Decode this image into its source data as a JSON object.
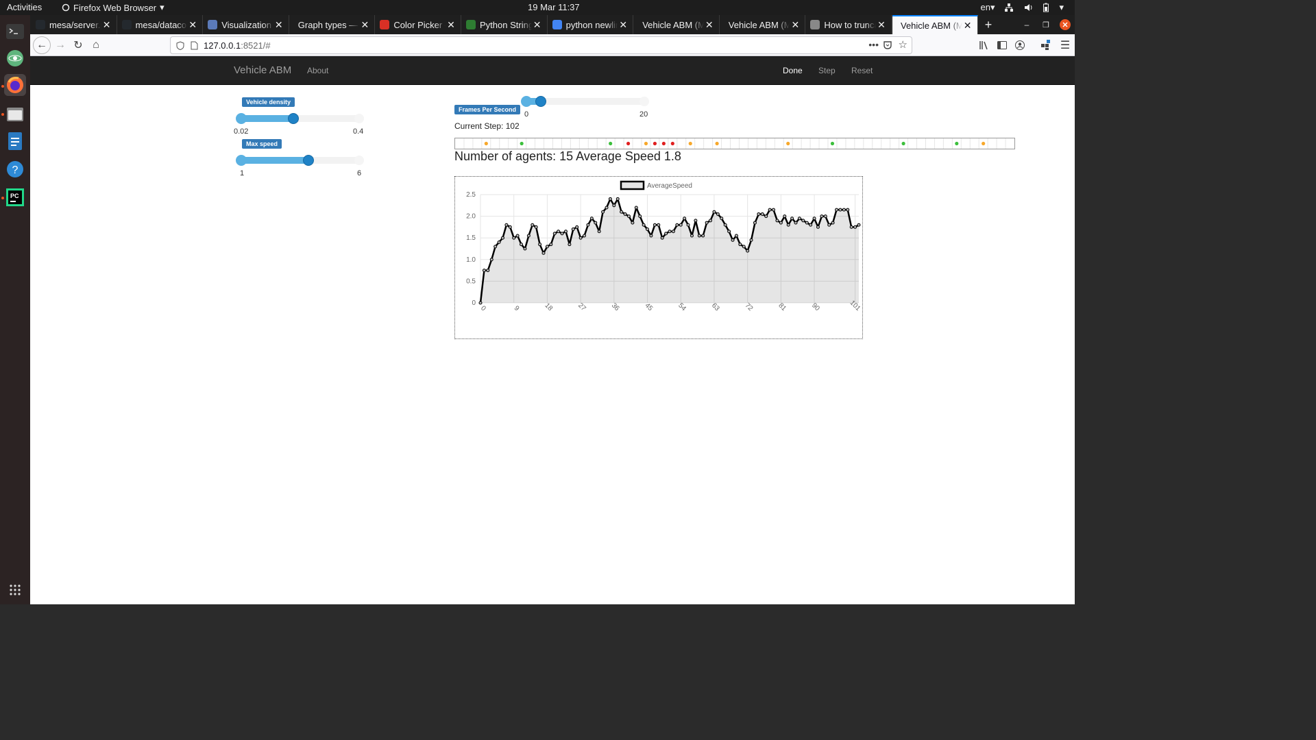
{
  "system": {
    "activities": "Activities",
    "app_menu": "Firefox Web Browser",
    "clock": "19 Mar  11:37",
    "lang": "en"
  },
  "tabs": [
    {
      "label": "mesa/server.p",
      "favicon_color": "#24292e"
    },
    {
      "label": "mesa/datacoll",
      "favicon_color": "#24292e"
    },
    {
      "label": "Visualization",
      "favicon_color": "#5b7ab8"
    },
    {
      "label": "Graph types — N",
      "favicon_color": ""
    },
    {
      "label": "Color Picker –",
      "favicon_color": "#d93025"
    },
    {
      "label": "Python String",
      "favicon_color": "#2e7d32"
    },
    {
      "label": "python newlin",
      "favicon_color": "#4285f4"
    },
    {
      "label": "Vehicle ABM (Me",
      "favicon_color": ""
    },
    {
      "label": "Vehicle ABM (Me",
      "favicon_color": ""
    },
    {
      "label": "How to trunca",
      "favicon_color": "#888888"
    },
    {
      "label": "Vehicle ABM (Me",
      "favicon_color": "",
      "active": true
    }
  ],
  "url": {
    "host": "127.0.0.1",
    "rest": ":8521/#"
  },
  "app": {
    "brand": "Vehicle ABM",
    "about": "About",
    "done": "Done",
    "step": "Step",
    "reset": "Reset"
  },
  "controls": {
    "vehicle_density": {
      "label": "Vehicle density",
      "min": "0.02",
      "max": "0.4",
      "value_fraction": 0.47
    },
    "max_speed": {
      "label": "Max speed",
      "min": "1",
      "max": "6",
      "value_fraction": 0.6
    },
    "fps": {
      "label": "Frames Per Second",
      "min": "0",
      "max": "20",
      "value_fraction": 0.15
    }
  },
  "status": {
    "current_step": "Current Step: 102",
    "agents_text": "Number of agents: 15 Average Speed 1.8"
  },
  "agents_row": {
    "colors": {
      "green": "#3cbf3c",
      "orange": "#f7a82b",
      "red": "#e02020"
    },
    "cells": 63,
    "agents": [
      {
        "cell": 3,
        "color": "orange"
      },
      {
        "cell": 7,
        "color": "green"
      },
      {
        "cell": 17,
        "color": "green"
      },
      {
        "cell": 19,
        "color": "red"
      },
      {
        "cell": 21,
        "color": "orange"
      },
      {
        "cell": 22,
        "color": "red"
      },
      {
        "cell": 23,
        "color": "red"
      },
      {
        "cell": 24,
        "color": "red"
      },
      {
        "cell": 26,
        "color": "orange"
      },
      {
        "cell": 29,
        "color": "orange"
      },
      {
        "cell": 37,
        "color": "orange"
      },
      {
        "cell": 42,
        "color": "green"
      },
      {
        "cell": 50,
        "color": "green"
      },
      {
        "cell": 56,
        "color": "green"
      },
      {
        "cell": 59,
        "color": "orange"
      }
    ]
  },
  "chart_data": {
    "type": "line",
    "legend": "AverageSpeed",
    "ylim": [
      0,
      2.5
    ],
    "yticks": [
      "0",
      "0.5",
      "1.0",
      "1.5",
      "2.0",
      "2.5"
    ],
    "xticks": [
      "0",
      "9",
      "18",
      "27",
      "36",
      "45",
      "54",
      "63",
      "72",
      "81",
      "90",
      "101"
    ],
    "grid": true,
    "series": [
      {
        "name": "AverageSpeed",
        "values": [
          0,
          0.75,
          0.75,
          1.0,
          1.3,
          1.4,
          1.5,
          1.8,
          1.75,
          1.5,
          1.55,
          1.35,
          1.25,
          1.55,
          1.8,
          1.75,
          1.35,
          1.15,
          1.3,
          1.35,
          1.6,
          1.65,
          1.6,
          1.65,
          1.35,
          1.7,
          1.75,
          1.5,
          1.55,
          1.8,
          1.95,
          1.85,
          1.65,
          2.1,
          2.2,
          2.4,
          2.25,
          2.4,
          2.1,
          2.05,
          2.0,
          1.85,
          2.2,
          2.0,
          1.8,
          1.7,
          1.55,
          1.8,
          1.8,
          1.5,
          1.6,
          1.65,
          1.65,
          1.8,
          1.8,
          1.95,
          1.8,
          1.55,
          1.9,
          1.55,
          1.55,
          1.85,
          1.9,
          2.1,
          2.05,
          1.95,
          1.8,
          1.65,
          1.45,
          1.55,
          1.35,
          1.3,
          1.2,
          1.45,
          1.85,
          2.05,
          2.05,
          2.0,
          2.15,
          2.15,
          1.9,
          1.85,
          2.0,
          1.8,
          1.95,
          1.85,
          1.95,
          1.9,
          1.85,
          1.8,
          1.95,
          1.75,
          2.0,
          2.0,
          1.8,
          1.85,
          2.15,
          2.15,
          2.15,
          2.15,
          1.75,
          1.75,
          1.8
        ]
      }
    ]
  }
}
